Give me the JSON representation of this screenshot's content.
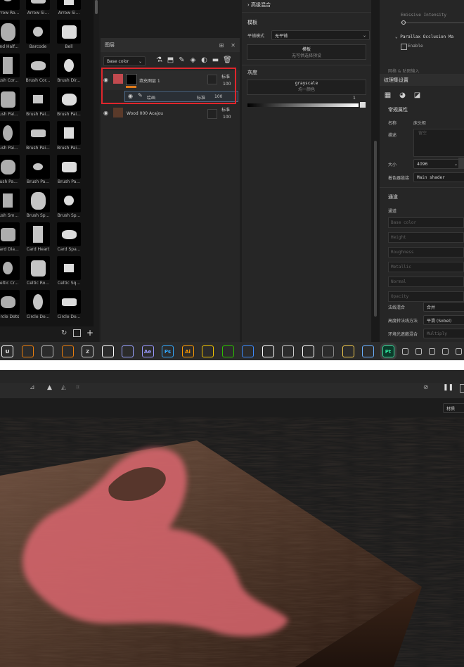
{
  "shelf": {
    "items": [
      {
        "label": "Arrow Ro...",
        "icon": "arrow-round-icon"
      },
      {
        "label": "Arrow Si...",
        "icon": "arrow-simple-icon"
      },
      {
        "label": "Arrow Si...",
        "icon": "arrow-simple-icon"
      },
      {
        "label": "and Half...",
        "icon": "band-halftone-icon"
      },
      {
        "label": "Barcode",
        "icon": "barcode-icon"
      },
      {
        "label": "Bell",
        "icon": "bell-icon"
      },
      {
        "label": "rush Cor...",
        "icon": "brush-corner-icon"
      },
      {
        "label": "Brush Cor...",
        "icon": "brush-corner-icon"
      },
      {
        "label": "Brush Dir...",
        "icon": "brush-dirt-icon"
      },
      {
        "label": "rush Pai...",
        "icon": "brush-paint-icon"
      },
      {
        "label": "Brush Pai...",
        "icon": "brush-paint-icon"
      },
      {
        "label": "Brush Pai...",
        "icon": "brush-paint-icon"
      },
      {
        "label": "rush Pai...",
        "icon": "brush-paint-icon"
      },
      {
        "label": "Brush Pai...",
        "icon": "brush-paint-icon"
      },
      {
        "label": "Brush Pai...",
        "icon": "brush-paint-icon"
      },
      {
        "label": "rush Pa...",
        "icon": "brush-paint-icon"
      },
      {
        "label": "Brush Pa...",
        "icon": "brush-paint-icon"
      },
      {
        "label": "Brush Pa...",
        "icon": "brush-paint-icon"
      },
      {
        "label": "rush Sm...",
        "icon": "brush-smudge-icon"
      },
      {
        "label": "Brush Sp...",
        "icon": "brush-splat-icon"
      },
      {
        "label": "Brush Sp...",
        "icon": "brush-splat-icon"
      },
      {
        "label": "Card Dia...",
        "icon": "card-diamond-icon"
      },
      {
        "label": "Card Heart",
        "icon": "card-heart-icon"
      },
      {
        "label": "Card Spa...",
        "icon": "card-spade-icon"
      },
      {
        "label": "Celtic Cr...",
        "icon": "celtic-cross-icon"
      },
      {
        "label": "Celtic Ro...",
        "icon": "celtic-rose-icon"
      },
      {
        "label": "Celtic Sq...",
        "icon": "celtic-square-icon"
      },
      {
        "label": "Circle Dots",
        "icon": "circle-dots-icon"
      },
      {
        "label": "Circle Do...",
        "icon": "circle-dots-icon"
      },
      {
        "label": "Circle Do...",
        "icon": "circle-ring-icon"
      }
    ]
  },
  "layers": {
    "title": "图层",
    "channel": "Base color",
    "rows": [
      {
        "name": "填充图层 1",
        "blend": "标准",
        "opacity": "100"
      },
      {
        "name": "绘画",
        "blend": "标准",
        "opacity": "100"
      },
      {
        "name": "Wood 000 Acajou",
        "blend": "标准",
        "opacity": "100"
      }
    ]
  },
  "props": {
    "blend_section": "高级混合",
    "stamp_section": "模板",
    "tile_label": "平铺模式",
    "tile_value": "无平铺",
    "template_button_title": "模板",
    "template_button_sub": "无可供选择预设",
    "gray_section": "灰度",
    "grayscale_title": "grayscale",
    "grayscale_sub": "均一颜色",
    "slider_max": "1"
  },
  "right": {
    "emissive": "Emissive Intensity",
    "parallax": "Parallax Occlusion Ma",
    "enable": "Enable",
    "cut_title": "网格 & 贴图输入",
    "tex_set_title": "纹理集设置",
    "general": "常规属性",
    "name_label": "名称",
    "name_value": "床头柜",
    "desc_label": "描述",
    "desc_placeholder": "留空",
    "size_label": "大小",
    "size_value": "4096",
    "shader_label": "着色器链接",
    "shader_value": "Main shader",
    "channels_title": "通道",
    "channels_label": "通道",
    "channel_list": [
      "Base color",
      "Height",
      "Roughness",
      "Metallic",
      "Normal",
      "Opacity"
    ],
    "normal_mix_label": "法线混合",
    "normal_mix_value": "合并",
    "h2n_label": "高度转法线方法",
    "h2n_value": "平滑 (Sobel)",
    "ao_label": "环境光遮蔽混合",
    "ao_value": "Multiply"
  },
  "taskbar": {
    "apps": [
      {
        "label": "U",
        "icon": "unreal-icon",
        "color": "#ffffff"
      },
      {
        "label": "",
        "icon": "blender-icon",
        "color": "#e87d0d"
      },
      {
        "label": "",
        "icon": "gear-app-icon",
        "color": "#bbbbbb"
      },
      {
        "label": "",
        "icon": "blender-icon",
        "color": "#e87d0d"
      },
      {
        "label": "Z",
        "icon": "zbrush-icon",
        "color": "#cccccc"
      },
      {
        "label": "",
        "icon": "capcut-icon",
        "color": "#ffffff"
      },
      {
        "label": "",
        "icon": "cloud-app-icon",
        "color": "#9aa4ff"
      },
      {
        "label": "Ae",
        "icon": "after-effects-icon",
        "color": "#9999ff"
      },
      {
        "label": "Ps",
        "icon": "photoshop-icon",
        "color": "#31a8ff"
      },
      {
        "label": "Ai",
        "icon": "illustrator-icon",
        "color": "#ff9a00"
      },
      {
        "label": "",
        "icon": "qq-icon",
        "color": "#f2c500"
      },
      {
        "label": "",
        "icon": "wechat-icon",
        "color": "#2dc100"
      },
      {
        "label": "",
        "icon": "feather-icon",
        "color": "#3a8bff"
      },
      {
        "label": "",
        "icon": "dots-app-icon",
        "color": "#ffffff"
      },
      {
        "label": "",
        "icon": "steam-icon",
        "color": "#cccccc"
      },
      {
        "label": "",
        "icon": "dots-app-icon",
        "color": "#ffffff"
      },
      {
        "label": "",
        "icon": "avatar-app-icon",
        "color": "#888888"
      },
      {
        "label": "",
        "icon": "folder-icon",
        "color": "#f2c94c"
      },
      {
        "label": "",
        "icon": "network-icon",
        "color": "#6ab0ff"
      },
      {
        "label": "Pt",
        "icon": "painter-icon",
        "color": "#2ee09a"
      }
    ],
    "tray": [
      "^",
      "shield",
      "app",
      "cloud",
      "volume"
    ]
  },
  "viewport": {
    "dropdown": "材质"
  }
}
